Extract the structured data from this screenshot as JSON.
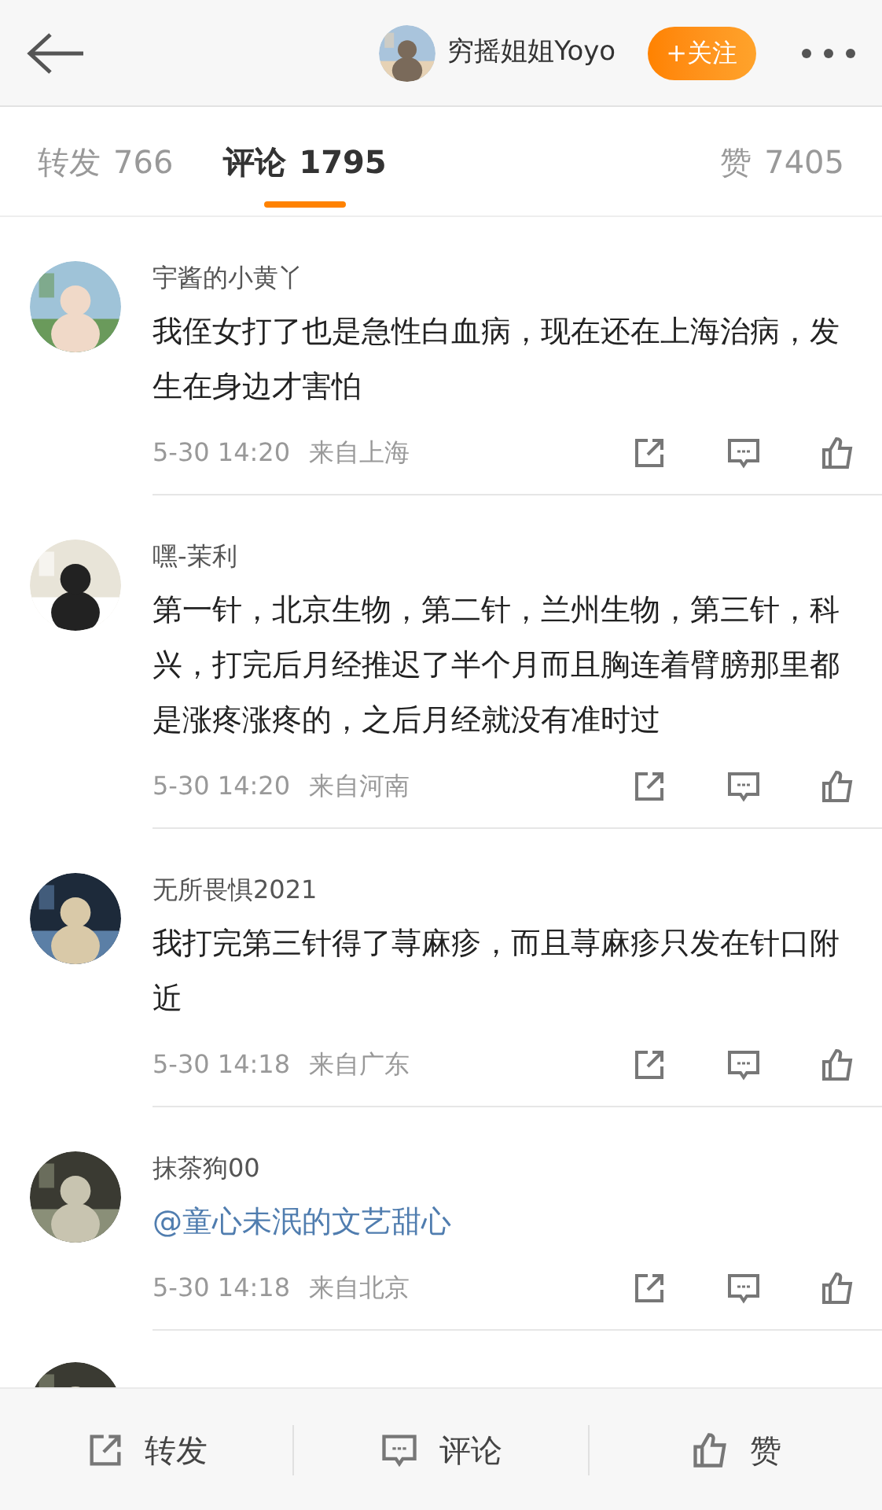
{
  "header": {
    "username": "穷摇姐姐Yoyo",
    "follow_button": "+关注"
  },
  "tabs": [
    {
      "label": "转发",
      "count": "766",
      "selected": false
    },
    {
      "label": "评论",
      "count": "1795",
      "selected": true
    },
    {
      "label": "赞",
      "count": "7405",
      "selected": false
    }
  ],
  "comments": [
    {
      "name": "宇酱的小黄丫",
      "body": "我侄女打了也是急性白血病，现在还在上海治病，发生在身边才害怕",
      "time": "5-30 14:20",
      "location": "来自上海"
    },
    {
      "name": "嘿-茉利",
      "body": "第一针，北京生物，第二针，兰州生物，第三针，科兴，打完后月经推迟了半个月而且胸连着臂膀那里都是涨疼涨疼的，之后月经就没有准时过",
      "time": "5-30 14:20",
      "location": "来自河南"
    },
    {
      "name": "无所畏惧2021",
      "body": "我打完第三针得了荨麻疹，而且荨麻疹只发在针口附近",
      "time": "5-30 14:18",
      "location": "来自广东"
    },
    {
      "name": "抹茶狗00",
      "mention": "@童心未泯的文艺甜心",
      "time": "5-30 14:18",
      "location": "来自北京"
    }
  ],
  "bottom_bar": [
    {
      "kind": "repost",
      "label": "转发"
    },
    {
      "kind": "comment",
      "label": "评论"
    },
    {
      "kind": "like",
      "label": "赞"
    }
  ]
}
